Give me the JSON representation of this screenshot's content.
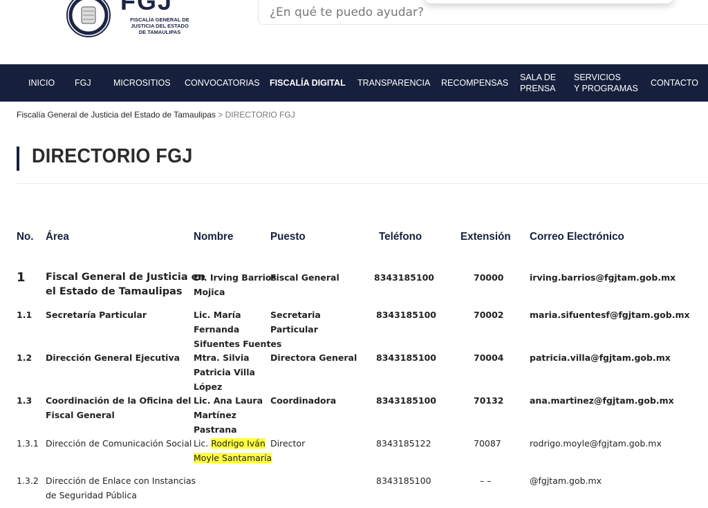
{
  "header": {
    "logo_mark": "FGJ",
    "logo_lines": [
      "FISCALÍA GENERAL DE",
      "JUSTICIA DEL ESTADO",
      "DE TAMAULIPAS"
    ],
    "search_placeholder": "¿En qué te puedo ayudar?"
  },
  "nav": {
    "items": [
      {
        "label": "INICIO"
      },
      {
        "label": "FGJ"
      },
      {
        "label": "MICROSITIOS"
      },
      {
        "label": "CONVOCATORIAS"
      },
      {
        "label": "FISCALÍA DIGITAL"
      },
      {
        "label": "TRANSPARENCIA"
      },
      {
        "label": "RECOMPENSAS"
      },
      {
        "label": "SALA DE\nPRENSA"
      },
      {
        "label": "SERVICIOS\nY PROGRAMAS"
      },
      {
        "label": "CONTACTO"
      }
    ]
  },
  "breadcrumb": {
    "root": "Fiscalía General de Justicia del Estado de Tamaulipas",
    "separator": ">",
    "current": "DIRECTORIO FGJ"
  },
  "page_title": "DIRECTORIO FGJ",
  "table": {
    "headers": [
      "No.",
      "Área",
      "Nombre",
      "Puesto",
      "Teléfono",
      "Extensión",
      "Correo Electrónico"
    ],
    "rows": [
      {
        "no": "1",
        "area": [
          "Fiscal General de Justicia en",
          "el Estado de Tamaulipas"
        ],
        "nombre": [
          "Dr. Irving Barrios",
          "Mojica"
        ],
        "puesto": [
          "Fiscal General"
        ],
        "telefono": "8343185100",
        "extension": "70000",
        "correo": "irving.barrios@fgjtam.gob.mx"
      },
      {
        "no": "1.1",
        "area": [
          "Secretaría Particular"
        ],
        "nombre": [
          "Lic. María",
          "Fernanda",
          "Sifuentes Fuentes"
        ],
        "puesto": [
          "Secretaria",
          "Particular"
        ],
        "telefono": "8343185100",
        "extension": "70002",
        "correo": "maria.sifuentesf@fgjtam.gob.mx"
      },
      {
        "no": "1.2",
        "area": [
          "Dirección General Ejecutiva"
        ],
        "nombre": [
          "Mtra. Silvia",
          "Patricia Villa",
          "López"
        ],
        "puesto": [
          "Directora General"
        ],
        "telefono": "8343185100",
        "extension": "70004",
        "correo": "patricia.villa@fgjtam.gob.mx"
      },
      {
        "no": "1.3",
        "area": [
          "Coordinación de la Oficina del",
          "Fiscal General"
        ],
        "nombre": [
          "Lic. Ana Laura",
          "Martínez",
          "Pastrana"
        ],
        "puesto": [
          "Coordinadora"
        ],
        "telefono": "8343185100",
        "extension": "70132",
        "correo": "ana.martinez@fgjtam.gob.mx"
      },
      {
        "no": "1.3.1",
        "area": [
          "Dirección de Comunicación Social"
        ],
        "nombre_prefix": "Lic.",
        "nombre_hl": [
          "Rodrigo Iván",
          "Moyle Santamaría"
        ],
        "puesto": [
          "Director"
        ],
        "telefono": "8343185122",
        "extension": "70087",
        "correo": "rodrigo.moyle@fgjtam.gob.mx"
      },
      {
        "no": "1.3.2",
        "area": [
          "Dirección de Enlace con Instancias",
          "de Seguridad Pública"
        ],
        "nombre": [],
        "puesto": [],
        "telefono": "8343185100",
        "extension": "– –",
        "correo": "@fgjtam.gob.mx"
      }
    ]
  },
  "colors": {
    "nav_bg": "#16203d",
    "header_text": "#16203d",
    "highlight": "#ffff3b"
  }
}
